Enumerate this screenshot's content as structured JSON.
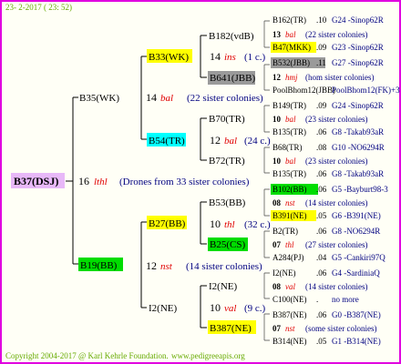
{
  "header": {
    "date": "23- 2-2017 ( 23: 52)"
  },
  "footer": {
    "copyright": "Copyright 2004-2017 @ Karl Kehrle Foundation.",
    "site": "www.pedigreeapis.org"
  },
  "root": {
    "id": "B37(DSJ)",
    "gen": "16",
    "code": "lthl",
    "note": "(Drones from 33 sister colonies)"
  },
  "sire": {
    "id": "B35(WK)",
    "gen": "14",
    "code": "bal",
    "note": "(22 sister colonies)"
  },
  "dam": {
    "id": "B19(BB)",
    "gen": "12",
    "code": "nst",
    "note": "(14 sister colonies)"
  },
  "ss": {
    "id": "B33(WK)",
    "gen": "14",
    "code": "ins",
    "note": "(1 c.)"
  },
  "sd": {
    "id": "B54(TR)",
    "gen": "12",
    "code": "bal",
    "note": "(24 c.)"
  },
  "ds": {
    "id": "B27(BB)",
    "gen": "10",
    "code": "thl",
    "note": "(32 c.)"
  },
  "dd": {
    "id": "I2(NE)",
    "gen": "10",
    "code": "val",
    "note": "(9 c.)"
  },
  "sss": {
    "id": "B182(vdB)"
  },
  "ssd": {
    "id": "B641(JBB)"
  },
  "sds": {
    "id": "B70(TR)"
  },
  "sdd": {
    "id": "B72(TR)"
  },
  "dss": {
    "id": "B53(BB)"
  },
  "dsd": {
    "id": "B25(CS)"
  },
  "dds": {
    "id": "I2(NE)"
  },
  "ddd": {
    "id": "B387(NE)"
  },
  "right": [
    {
      "a": "B162(TR)",
      "b": ".10",
      "c": "G24 -Sinop62R"
    },
    {
      "a": "13",
      "r": "bal",
      "n": "(22 sister colonies)"
    },
    {
      "a": "B47(MKK)",
      "b": ".09",
      "c": "G23 -Sinop62R"
    },
    {
      "a": "B532(JBB)",
      "b": ".11",
      "c": "G27 -Sinop62R"
    },
    {
      "a": "12",
      "r": "hmj",
      "n": "(hom sister colonies)"
    },
    {
      "a": "PoolBhom12(JBB)",
      "c": "PoolBhom12(FK)+3"
    },
    {
      "a": "B149(TR)",
      "b": ".09",
      "c": "G24 -Sinop62R"
    },
    {
      "a": "10",
      "r": "bal",
      "n": "(23 sister colonies)"
    },
    {
      "a": "B135(TR)",
      "b": ".06",
      "c": "G8 -Takab93aR"
    },
    {
      "a": "B68(TR)",
      "b": ".08",
      "c": "G10 -NO6294R"
    },
    {
      "a": "10",
      "r": "bal",
      "n": "(23 sister colonies)"
    },
    {
      "a": "B135(TR)",
      "b": ".06",
      "c": "G8 -Takab93aR"
    },
    {
      "a": "B102(BB)",
      "b": ".06",
      "c": "G5 -Bayburt98-3"
    },
    {
      "a": "08",
      "r": "nst",
      "n": "(14 sister colonies)"
    },
    {
      "a": "B391(NE)",
      "b": ".05",
      "c": "G6 -B391(NE)"
    },
    {
      "a": "B2(TR)",
      "b": ".06",
      "c": "G8 -NO6294R"
    },
    {
      "a": "07",
      "r": "thl",
      "n": "(27 sister colonies)"
    },
    {
      "a": "A284(PJ)",
      "b": ".04",
      "c": "G5 -Cankiri97Q"
    },
    {
      "a": "I2(NE)",
      "b": ".06",
      "c": "G4 -SardiniaQ"
    },
    {
      "a": "08",
      "r": "val",
      "n": "(14 sister colonies)"
    },
    {
      "a": "C100(NE)",
      "b": ".",
      "c": "no more"
    },
    {
      "a": "B387(NE)",
      "b": ".06",
      "c": "G0 -B387(NE)"
    },
    {
      "a": "07",
      "r": "nst",
      "n": "(some sister colonies)"
    },
    {
      "a": "B314(NE)",
      "b": ".05",
      "c": "G1 -B314(NE)"
    }
  ],
  "colors": {
    "frame": "#e000e0",
    "root_bg": "#e8b8f8",
    "yellow": "#ffff00",
    "cyan": "#00ffff",
    "green": "#00dd00",
    "gray": "#9a9a9a",
    "code": "#e00000",
    "blue": "#000080"
  }
}
